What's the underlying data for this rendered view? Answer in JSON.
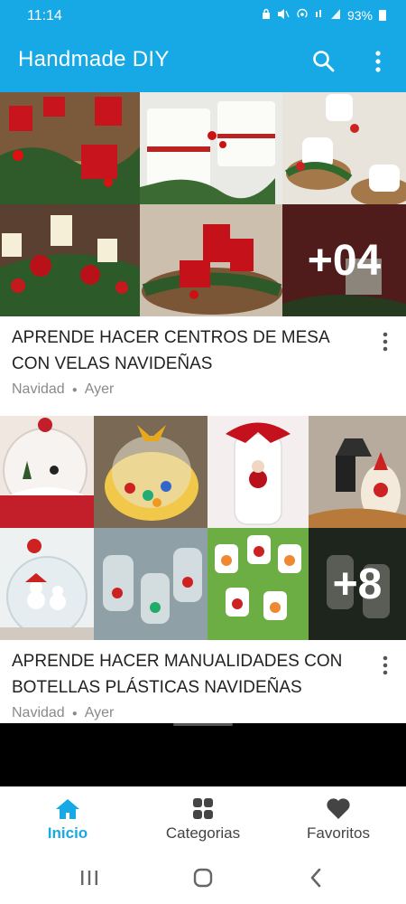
{
  "status_bar": {
    "time": "11:14",
    "battery": "93%",
    "icons": [
      "lock-icon",
      "mute-icon",
      "hotspot-icon",
      "signal-icon",
      "wifi-signal-icon"
    ]
  },
  "app_bar": {
    "title": "Handmade DIY",
    "actions": [
      "search-icon",
      "more-vert-icon"
    ],
    "color": "#17a9e6"
  },
  "posts": [
    {
      "title": "APRENDE HACER CENTROS DE MESA CON VELAS NAVIDEÑAS",
      "category": "Navidad",
      "date": "Ayer",
      "more_count": "+04"
    },
    {
      "title": "APRENDE HACER MANUALIDADES CON BOTELLAS PLÁSTICAS NAVIDEÑAS",
      "category": "Navidad",
      "date": "Ayer",
      "more_count": "+8"
    }
  ],
  "bottom_nav": {
    "items": [
      {
        "label": "Inicio",
        "icon": "home-icon",
        "active": true
      },
      {
        "label": "Categorias",
        "icon": "grid-icon",
        "active": false
      },
      {
        "label": "Favoritos",
        "icon": "heart-icon",
        "active": false
      }
    ],
    "accent": "#17a9e6"
  },
  "system_nav": [
    "recents-icon",
    "home-circle-icon",
    "back-icon"
  ]
}
